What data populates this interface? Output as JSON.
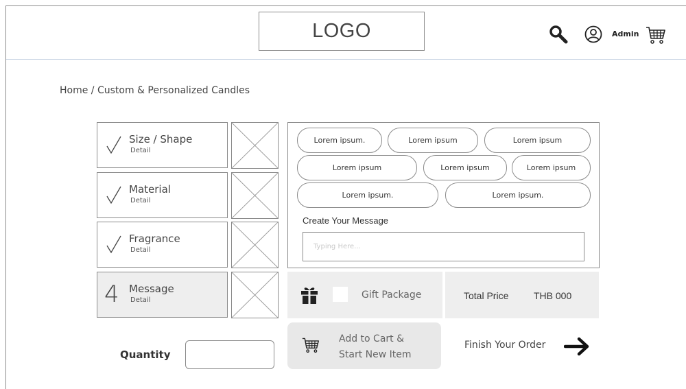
{
  "header": {
    "logo": "LOGO",
    "admin_label": "Admin",
    "icons": [
      "search-icon",
      "user-icon",
      "cart-icon"
    ]
  },
  "breadcrumb": "Home / Custom & Personalized Candles",
  "steps": [
    {
      "marker": "check",
      "title": "Size / Shape",
      "detail": "Detail"
    },
    {
      "marker": "check",
      "title": "Material",
      "detail": "Detail"
    },
    {
      "marker": "check",
      "title": "Fragrance",
      "detail": "Detail"
    },
    {
      "marker": "4",
      "title": "Message",
      "detail": "Detail",
      "active": true
    }
  ],
  "options": [
    "Lorem ipsum.",
    "Lorem ipsum",
    "Lorem ipsum",
    "Lorem ipsum",
    "Lorem ipsum",
    "Lorem ipsum",
    "Lorem ipsum.",
    "Lorem ipsum."
  ],
  "message": {
    "label": "Create Your Message",
    "placeholder": "Typing Here..."
  },
  "gift": {
    "label": "Gift Package",
    "checked": false
  },
  "price": {
    "label": "Total Price",
    "value": "THB 000"
  },
  "quantity": {
    "label": "Quantity",
    "value": ""
  },
  "actions": {
    "add_to_cart_line1": "Add to Cart &",
    "add_to_cart_line2": "Start New Item",
    "finish": "Finish Your Order"
  },
  "colors": {
    "panel_gray": "#eeeeee",
    "border": "#8a8a8a",
    "header_divider": "#c9d4e4"
  }
}
